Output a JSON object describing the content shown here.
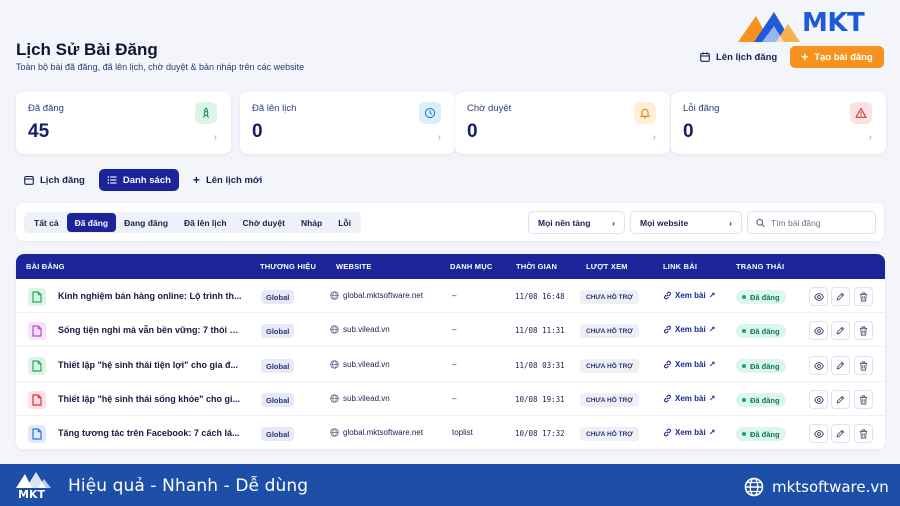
{
  "brand": {
    "logo_text": "MKT"
  },
  "header": {
    "title": "Lịch Sử Bài Đăng",
    "subtitle": "Toàn bộ bài đã đăng, đã lên lịch, chờ duyệt & bản nháp trên các website",
    "schedule_label": "Lên lịch đăng",
    "create_label": "Tạo bài đăng"
  },
  "stats": [
    {
      "label": "Đã đăng",
      "value": "45",
      "icon": "rocket-icon",
      "color": "#1c8f5a"
    },
    {
      "label": "Đã lên lịch",
      "value": "0",
      "icon": "clock-icon",
      "color": "#1f84d6"
    },
    {
      "label": "Chờ duyệt",
      "value": "0",
      "icon": "bell-icon",
      "color": "#e08a10"
    },
    {
      "label": "Lỗi đăng",
      "value": "0",
      "icon": "warning-icon",
      "color": "#d8323a"
    }
  ],
  "view_tabs": [
    {
      "label": "Lịch đăng",
      "icon": "calendar-icon"
    },
    {
      "label": "Danh sách",
      "icon": "list-icon",
      "active": true
    },
    {
      "label": "Lên lịch mới",
      "icon": "plus-icon"
    }
  ],
  "filters": {
    "status_tabs": [
      "Tất cả",
      "Đã đăng",
      "Đang đăng",
      "Đã lên lịch",
      "Chờ duyệt",
      "Nháp",
      "Lỗi"
    ],
    "active_status": "Đã đăng",
    "platform_select": "Mọi nền tảng",
    "website_select": "Mọi website",
    "search_placeholder": "Tìm bài đăng"
  },
  "table": {
    "headers": [
      "BÀI ĐĂNG",
      "THƯƠNG HIỆU",
      "WEBSITE",
      "DANH MỤC",
      "THỜI GIAN",
      "LƯỢT XEM",
      "LINK BÀI",
      "TRẠNG THÁI"
    ],
    "rows": [
      {
        "title": "Kinh nghiệm bán hàng online: Lộ trình th...",
        "brand": "Global",
        "website": "global.mktsoftware.net",
        "category": "–",
        "time": "11/08 16:48",
        "views": "CHƯA HỖ TRỢ",
        "link": "Xem bài",
        "status": "Đã đăng",
        "doc_color": "#2aa55a",
        "doc_bg": "#ddf5e6"
      },
      {
        "title": "Sống tiện nghi mà vẫn bền vững: 7 thói q...",
        "brand": "Global",
        "website": "sub.vilead.vn",
        "category": "–",
        "time": "11/08 11:31",
        "views": "CHƯA HỖ TRỢ",
        "link": "Xem bài",
        "status": "Đã đăng",
        "doc_color": "#b648d8",
        "doc_bg": "#f5e2fb"
      },
      {
        "title": "Thiết lập \"hệ sinh thái tiện lợi\" cho gia đ...",
        "brand": "Global",
        "website": "sub.vilead.vn",
        "category": "–",
        "time": "11/08 03:31",
        "views": "CHƯA HỖ TRỢ",
        "link": "Xem bài",
        "status": "Đã đăng",
        "doc_color": "#2aa55a",
        "doc_bg": "#ddf5e6"
      },
      {
        "title": "Thiết lập \"hệ sinh thái sống khỏe\" cho gi...",
        "brand": "Global",
        "website": "sub.vilead.vn",
        "category": "–",
        "time": "10/08 19:31",
        "views": "CHƯA HỖ TRỢ",
        "link": "Xem bài",
        "status": "Đã đăng",
        "doc_color": "#d8323a",
        "doc_bg": "#fbe1e2"
      },
      {
        "title": "Tăng tương tác trên Facebook: 7 cách lá...",
        "brand": "Global",
        "website": "global.mktsoftware.net",
        "category": "toplist",
        "time": "10/08 17:32",
        "views": "CHƯA HỖ TRỢ",
        "link": "Xem bài",
        "status": "Đã đăng",
        "doc_color": "#2f6fe0",
        "doc_bg": "#e0eafb"
      }
    ]
  },
  "footer": {
    "logo_text": "MKT",
    "tagline": "Hiệu quả - Nhanh - Dễ dùng",
    "website": "mktsoftware.vn"
  }
}
